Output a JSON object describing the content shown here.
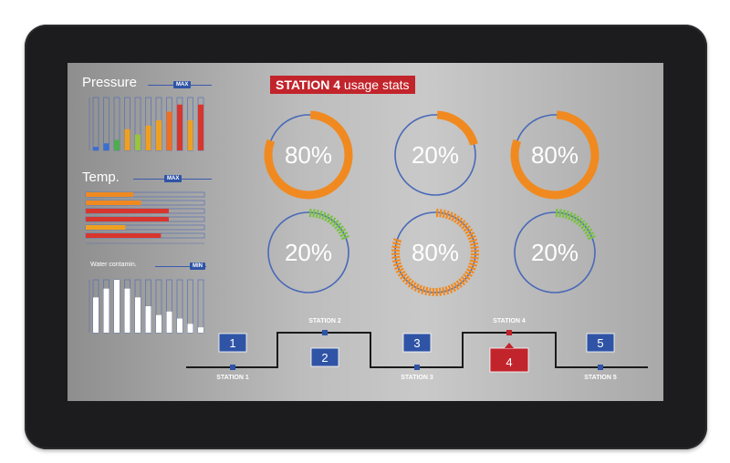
{
  "pressure": {
    "title": "Pressure",
    "badge": "MAX",
    "values": [
      2,
      4,
      6,
      12,
      9,
      14,
      17,
      22,
      26,
      17,
      26
    ],
    "colors": [
      "#3b6fd1",
      "#3b6fd1",
      "#4cae4c",
      "#f0a020",
      "#9ac43c",
      "#f0a020",
      "#f0a020",
      "#f07020",
      "#d8362d",
      "#f0a020",
      "#d8362d"
    ],
    "max": 30
  },
  "temp": {
    "title": "Temp.",
    "badge": "MAX",
    "bars": [
      {
        "value": 12,
        "color": "#f08a20"
      },
      {
        "value": 14,
        "color": "#f08a20"
      },
      {
        "value": 21,
        "color": "#d8362d"
      },
      {
        "value": 21,
        "color": "#d8362d"
      },
      {
        "value": 10,
        "color": "#f0a020"
      },
      {
        "value": 19,
        "color": "#d8362d"
      }
    ],
    "max": 30
  },
  "water": {
    "title": "Water contamin.",
    "badge": "MIN",
    "values": [
      20,
      25,
      30,
      25,
      20,
      15,
      10,
      12,
      8,
      5,
      3
    ],
    "max": 30
  },
  "header": {
    "bold": "STATION 4",
    "rest": " usage stats"
  },
  "gauges": [
    {
      "label": "80%",
      "fraction": 0.8,
      "color": "#f08a20",
      "style": "solid"
    },
    {
      "label": "20%",
      "fraction": 0.2,
      "color": "#f08a20",
      "style": "solid"
    },
    {
      "label": "80%",
      "fraction": 0.8,
      "color": "#f08a20",
      "style": "solid"
    },
    {
      "label": "20%",
      "fraction": 0.2,
      "color": "#7ac143",
      "style": "ticks"
    },
    {
      "label": "80%",
      "fraction": 0.8,
      "color": "#f08a20",
      "style": "ticks"
    },
    {
      "label": "20%",
      "fraction": 0.2,
      "color": "#7ac143",
      "style": "ticks"
    }
  ],
  "stations": [
    {
      "name": "STATION 1",
      "number": "1",
      "active": false
    },
    {
      "name": "STATION 2",
      "number": "2",
      "active": false
    },
    {
      "name": "STATION 3",
      "number": "3",
      "active": false
    },
    {
      "name": "STATION 4",
      "number": "4",
      "active": true
    },
    {
      "name": "STATION 5",
      "number": "5",
      "active": false
    }
  ],
  "colors": {
    "accent_red": "#c2242b",
    "accent_blue": "#2f54a6",
    "ring_blue": "#4a69b8"
  }
}
